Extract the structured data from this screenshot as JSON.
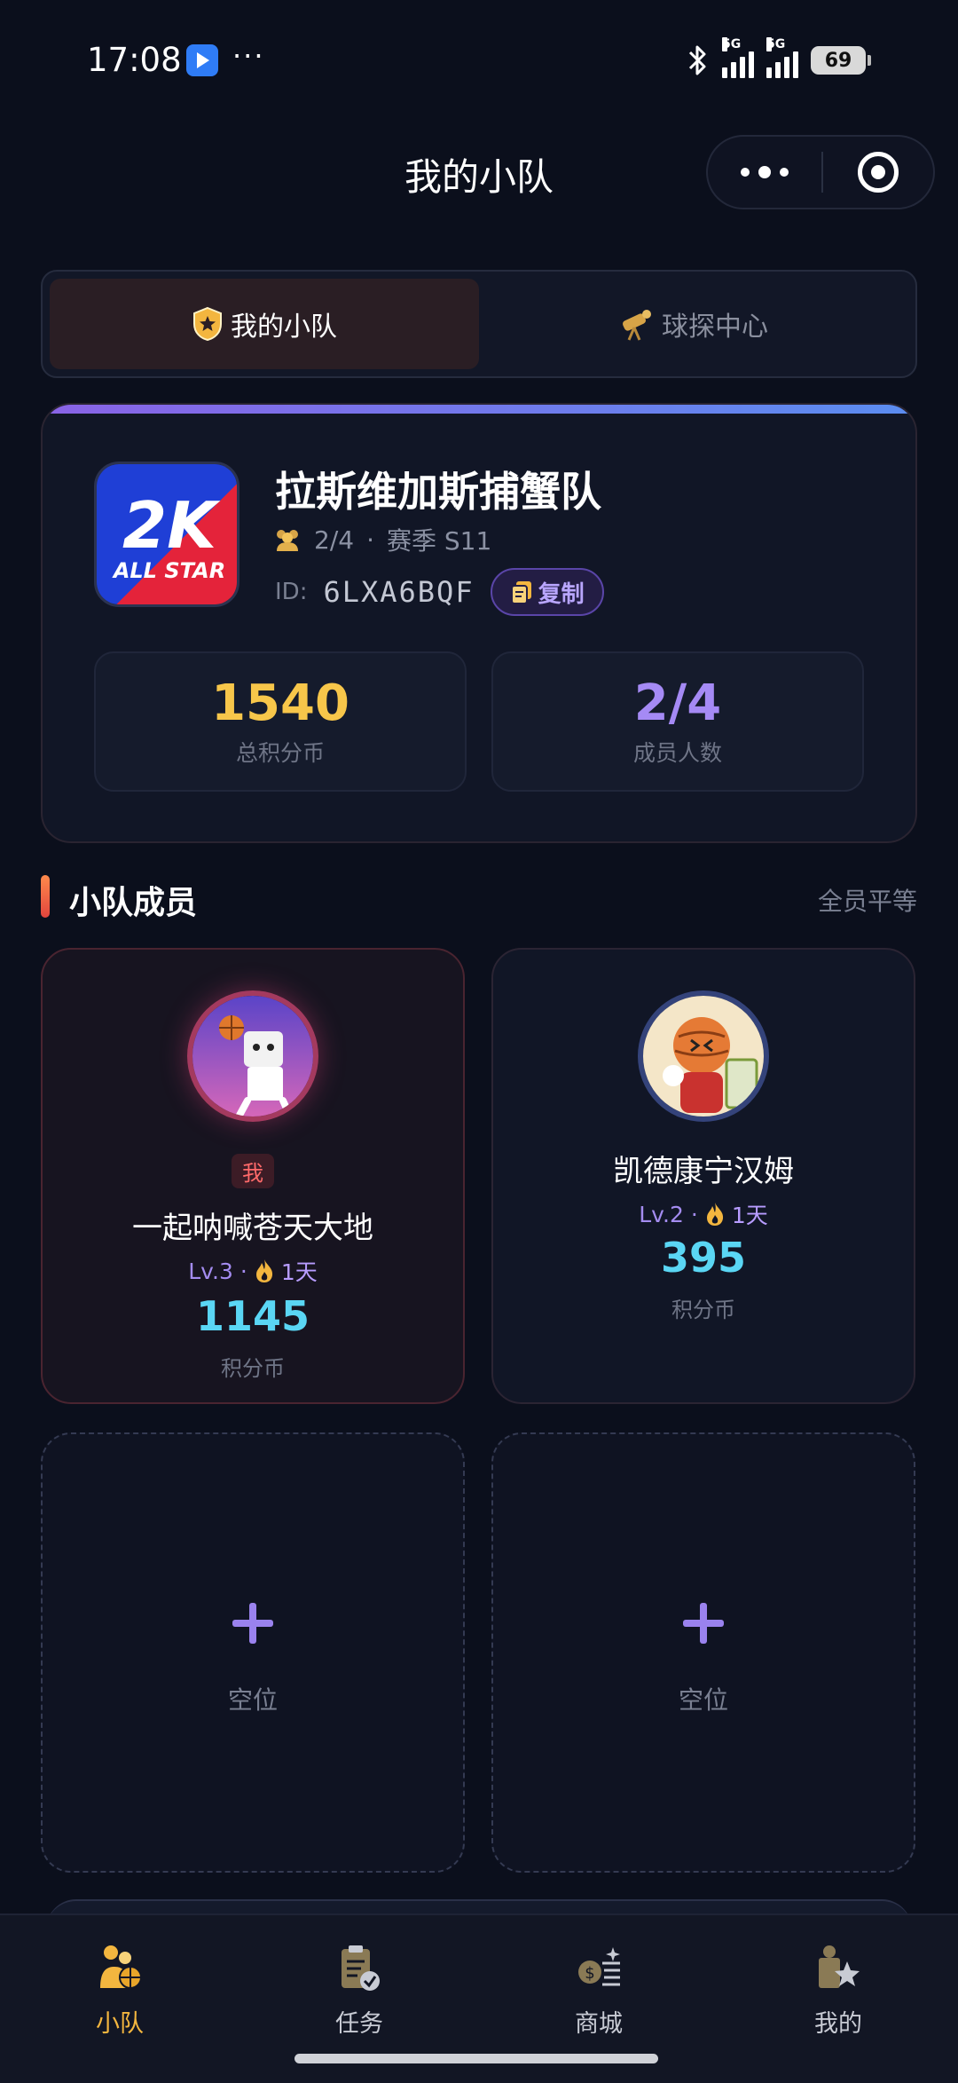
{
  "status_bar": {
    "time": "17:08",
    "dots": "···",
    "net1": "5G",
    "net2": "5G",
    "battery": "69"
  },
  "header": {
    "title": "我的小队"
  },
  "segment": {
    "tabs": [
      {
        "label": "我的小队",
        "active": true
      },
      {
        "label": "球探中心",
        "active": false
      }
    ]
  },
  "team": {
    "name": "拉斯维加斯捕蟹队",
    "logo_text_top": "2K",
    "logo_text_bottom": "ALL STAR",
    "members_fraction": "2/4",
    "season": "赛季 S11",
    "id_label": "ID:",
    "id_value": "6LXA6BQF",
    "copy_label": "复制",
    "stats": [
      {
        "value": "1540",
        "label": "总积分币",
        "color": "#f7c64a"
      },
      {
        "value": "2/4",
        "label": "成员人数",
        "color": "#a58af5"
      }
    ]
  },
  "members_section": {
    "title": "小队成员",
    "right_text": "全员平等"
  },
  "members": [
    {
      "is_me": true,
      "me_badge": "我",
      "name": "一起呐喊苍天大地",
      "level": "Lv.3",
      "streak": "1天",
      "points": "1145",
      "unit": "积分币"
    },
    {
      "is_me": false,
      "name": "凯德康宁汉姆",
      "level": "Lv.2",
      "streak": "1天",
      "points": "395",
      "unit": "积分币"
    }
  ],
  "empty_slots": [
    {
      "label": "空位"
    },
    {
      "label": "空位"
    }
  ],
  "bottom_nav": [
    {
      "label": "小队",
      "icon": "team-icon",
      "active": true
    },
    {
      "label": "任务",
      "icon": "task-icon",
      "active": false
    },
    {
      "label": "商城",
      "icon": "shop-icon",
      "active": false
    },
    {
      "label": "我的",
      "icon": "profile-icon",
      "active": false
    }
  ],
  "colors": {
    "accent_gold": "#f3b63f",
    "accent_purple": "#a58af5",
    "points_cyan": "#5ad6f4",
    "background": "#0b0f1c"
  }
}
